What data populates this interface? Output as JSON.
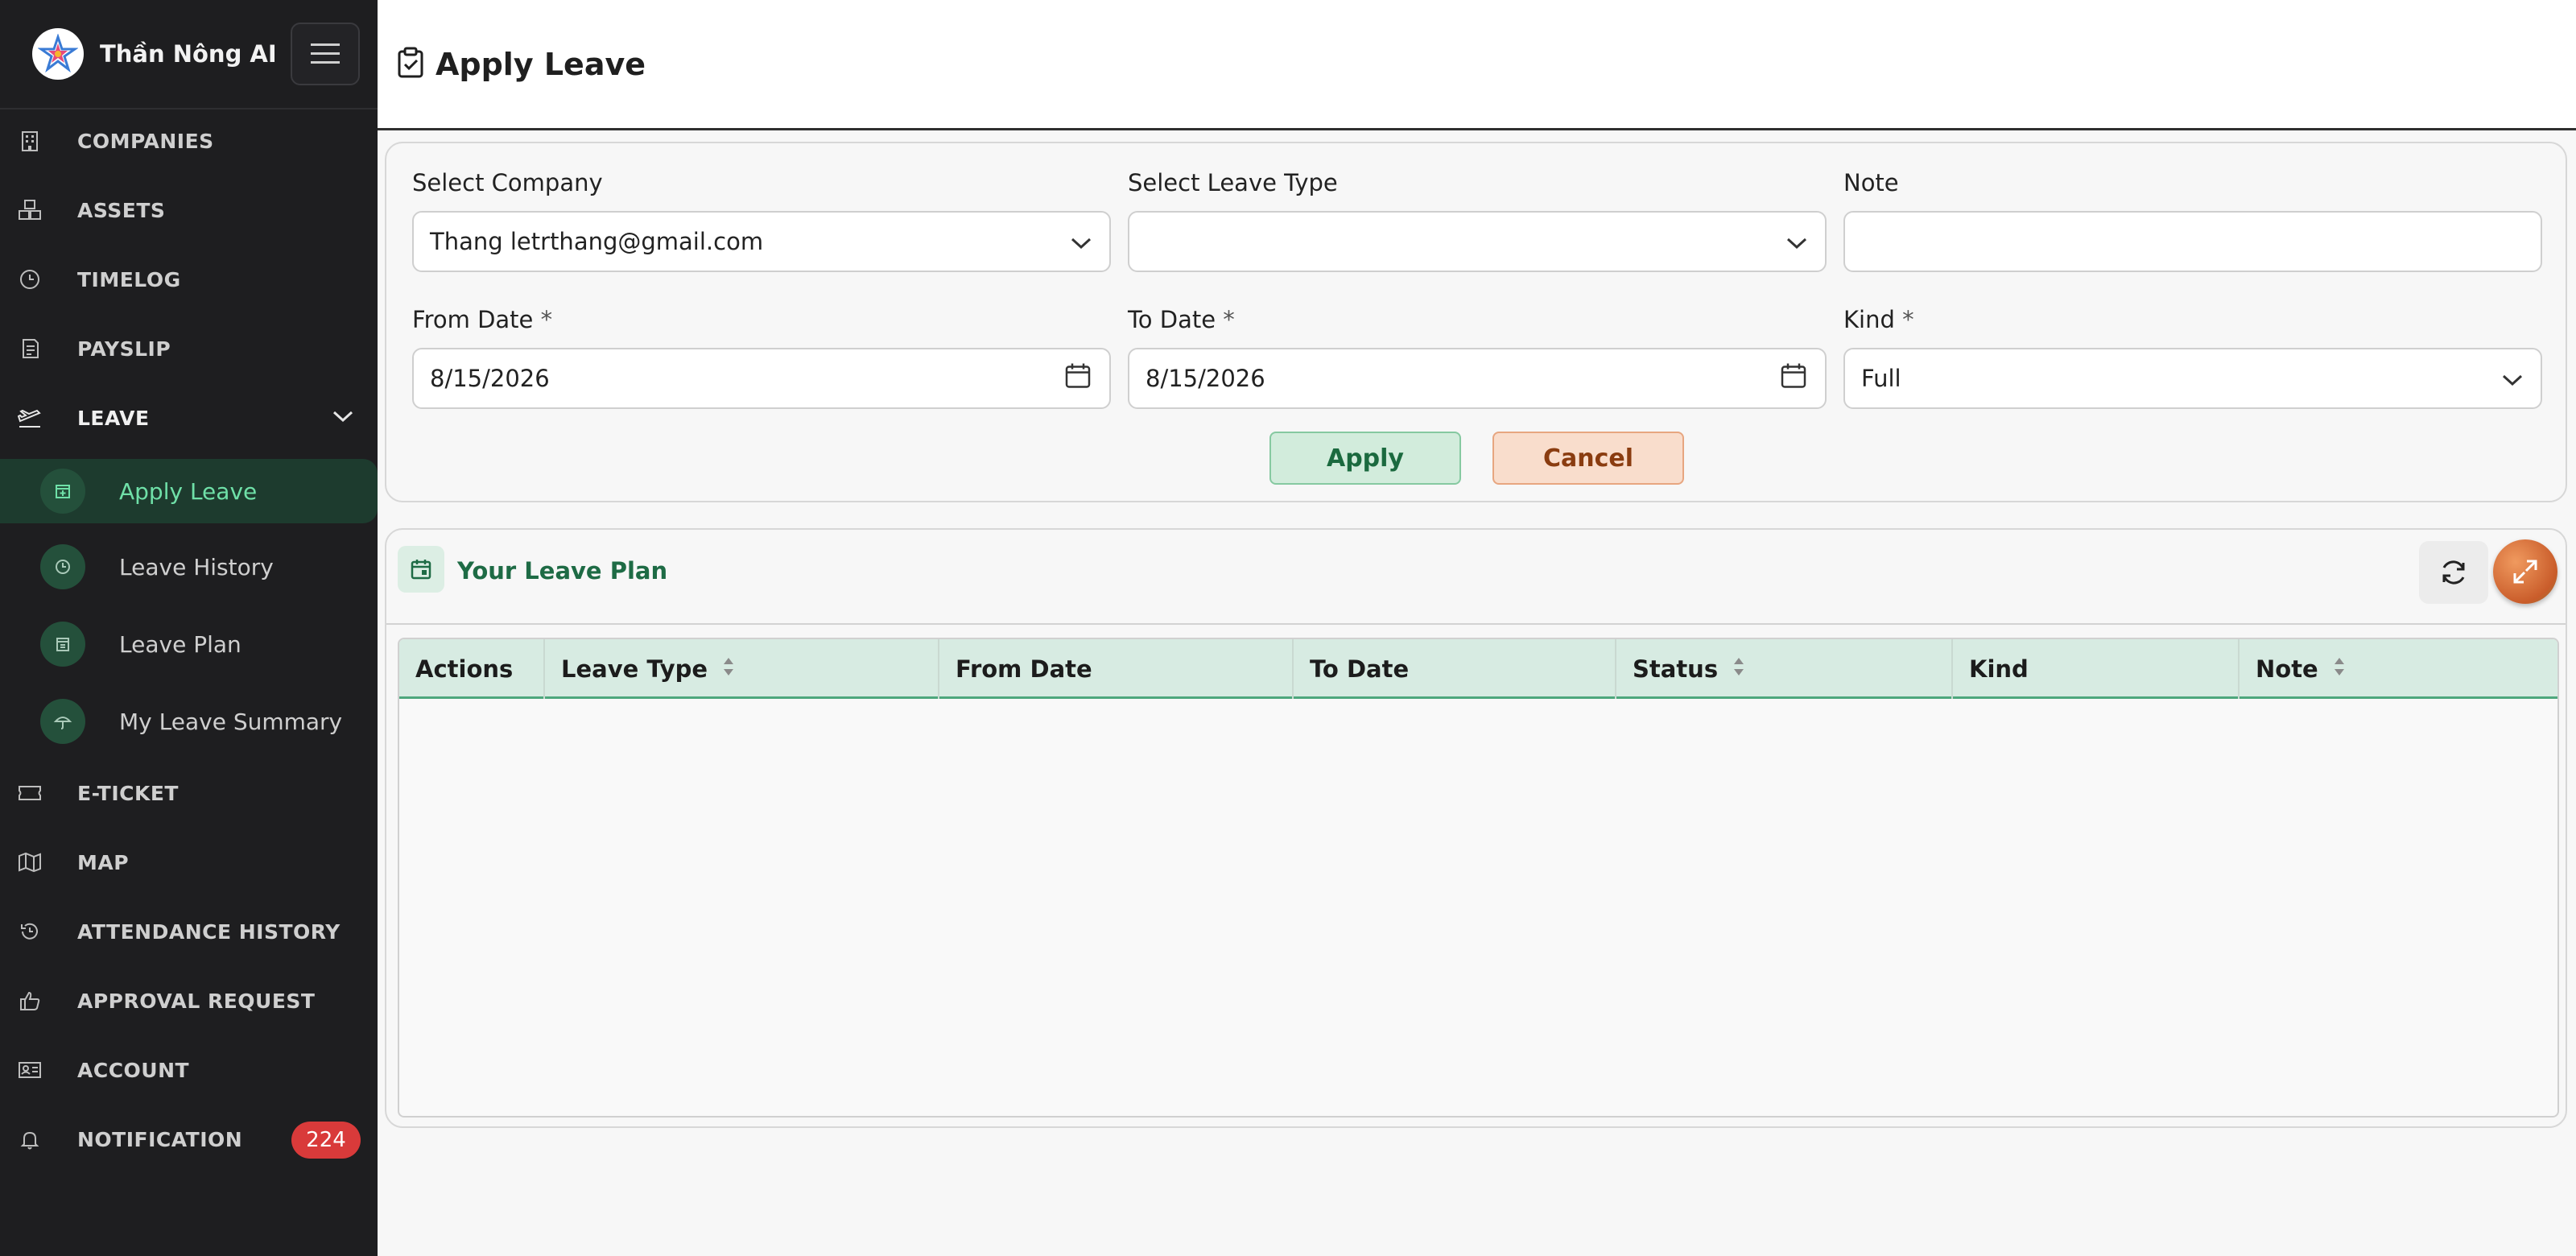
{
  "app": {
    "name": "Thần Nông AI"
  },
  "sidebar": {
    "items": [
      {
        "label": "COMPANIES",
        "icon": "building-icon"
      },
      {
        "label": "ASSETS",
        "icon": "boxes-icon"
      },
      {
        "label": "TIMELOG",
        "icon": "clock-icon"
      },
      {
        "label": "PAYSLIP",
        "icon": "receipt-icon"
      },
      {
        "label": "LEAVE",
        "icon": "plane-departure-icon",
        "expanded": true
      },
      {
        "label": "E-TICKET",
        "icon": "ticket-icon"
      },
      {
        "label": "MAP",
        "icon": "map-icon"
      },
      {
        "label": "ATTENDANCE HISTORY",
        "icon": "history-icon"
      },
      {
        "label": "APPROVAL REQUEST",
        "icon": "thumbs-up-icon"
      },
      {
        "label": "ACCOUNT",
        "icon": "id-card-icon"
      },
      {
        "label": "NOTIFICATION",
        "icon": "bell-icon",
        "badge": "224"
      }
    ],
    "leave_sub": [
      {
        "label": "Apply Leave",
        "icon": "calendar-plus-icon",
        "active": true
      },
      {
        "label": "Leave History",
        "icon": "history-icon"
      },
      {
        "label": "Leave Plan",
        "icon": "calendar-icon"
      },
      {
        "label": "My Leave Summary",
        "icon": "umbrella-icon"
      }
    ]
  },
  "header": {
    "title": "Apply Leave",
    "icon": "clipboard-check-icon"
  },
  "form": {
    "company": {
      "label": "Select Company",
      "value": "Thang letrthang@gmail.com"
    },
    "leave_type": {
      "label": "Select Leave Type",
      "value": ""
    },
    "note": {
      "label": "Note",
      "value": ""
    },
    "from_date": {
      "label": "From Date",
      "value": "8/15/2026"
    },
    "to_date": {
      "label": "To Date",
      "value": "8/15/2026"
    },
    "kind": {
      "label": "Kind",
      "value": "Full"
    },
    "required_mark": "*",
    "apply_label": "Apply",
    "cancel_label": "Cancel",
    "colors": {
      "apply_bg": "#d2ecdc",
      "cancel_bg": "#f9ddcc"
    }
  },
  "plan": {
    "title": "Your Leave Plan",
    "columns": [
      "Actions",
      "Leave Type",
      "From Date",
      "To Date",
      "Status",
      "Kind",
      "Note"
    ],
    "sortable": [
      false,
      true,
      false,
      false,
      true,
      false,
      true
    ],
    "rows": []
  },
  "colors": {
    "sidebar_bg": "#1e1e20",
    "accent_green": "#1e6b45",
    "badge_red": "#d93a3a"
  }
}
